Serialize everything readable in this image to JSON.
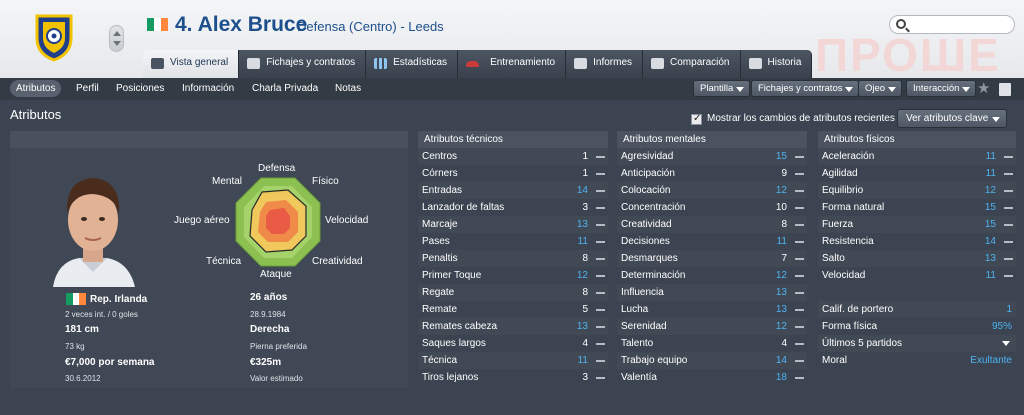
{
  "header": {
    "player_title": "4. Alex Bruce",
    "subtitle": "Defensa (Centro) - Leeds",
    "watermark": "ПРОШЕ",
    "flag_colors": [
      "#169b62",
      "#ffffff",
      "#ff883e"
    ]
  },
  "tabs": [
    {
      "label": "Vista general",
      "icon": "overview-icon",
      "active": true
    },
    {
      "label": "Fichajes y contratos",
      "icon": "contract-icon"
    },
    {
      "label": "Estadísticas",
      "icon": "stats-icon"
    },
    {
      "label": "Entrenamiento",
      "icon": "training-icon"
    },
    {
      "label": "Informes",
      "icon": "report-icon"
    },
    {
      "label": "Comparación",
      "icon": "compare-icon"
    },
    {
      "label": "Historia",
      "icon": "history-icon"
    }
  ],
  "subnav": {
    "items": [
      "Atributos",
      "Perfil",
      "Posiciones",
      "Información",
      "Charla Privada",
      "Notas"
    ],
    "dropdowns": [
      "Plantilla",
      "Fichajes y contratos",
      "Ojeo",
      "Interacción"
    ]
  },
  "section": {
    "title": "Atributos",
    "checkbox_label": "Mostrar los cambios de atributos recientes",
    "key_button": "Ver atributos clave"
  },
  "radar": {
    "labels": {
      "top": "Defensa",
      "top_right": "Físico",
      "right": "Velocidad",
      "bottom_right": "Creatividad",
      "bottom": "Ataque",
      "bottom_left": "Técnica",
      "left": "Juego aéreo",
      "top_left": "Mental"
    }
  },
  "player": {
    "nation": "Rep. Irlanda",
    "caps": "2 veces int. / 0 goles",
    "height": "181 cm",
    "weight": "73 kg",
    "wage": "€7,000 por semana",
    "contract_end": "30.6.2012",
    "age": "26 años",
    "birthdate": "28.9.1984",
    "foot": "Derecha",
    "foot_label": "Pierna preferida",
    "value": "€325m",
    "value_label": "Valor estimado"
  },
  "technical": {
    "header": "Atributos técnicos",
    "rows": [
      {
        "name": "Centros",
        "value": "1"
      },
      {
        "name": "Córners",
        "value": "1"
      },
      {
        "name": "Entradas",
        "value": "14",
        "hi": true
      },
      {
        "name": "Lanzador de faltas",
        "value": "3"
      },
      {
        "name": "Marcaje",
        "value": "13",
        "hi": true
      },
      {
        "name": "Pases",
        "value": "11",
        "hi": true
      },
      {
        "name": "Penaltis",
        "value": "8"
      },
      {
        "name": "Primer Toque",
        "value": "12",
        "hi": true
      },
      {
        "name": "Regate",
        "value": "8"
      },
      {
        "name": "Remate",
        "value": "5"
      },
      {
        "name": "Remates cabeza",
        "value": "13",
        "hi": true
      },
      {
        "name": "Saques largos",
        "value": "4"
      },
      {
        "name": "Técnica",
        "value": "11",
        "hi": true
      },
      {
        "name": "Tiros lejanos",
        "value": "3"
      }
    ]
  },
  "mental": {
    "header": "Atributos mentales",
    "rows": [
      {
        "name": "Agresividad",
        "value": "15",
        "hi": true
      },
      {
        "name": "Anticipación",
        "value": "9"
      },
      {
        "name": "Colocación",
        "value": "12",
        "hi": true
      },
      {
        "name": "Concentración",
        "value": "10"
      },
      {
        "name": "Creatividad",
        "value": "8"
      },
      {
        "name": "Decisiones",
        "value": "11",
        "hi": true
      },
      {
        "name": "Desmarques",
        "value": "7"
      },
      {
        "name": "Determinación",
        "value": "12",
        "hi": true
      },
      {
        "name": "Influencia",
        "value": "13",
        "hi": true
      },
      {
        "name": "Lucha",
        "value": "13",
        "hi": true
      },
      {
        "name": "Serenidad",
        "value": "12",
        "hi": true
      },
      {
        "name": "Talento",
        "value": "4"
      },
      {
        "name": "Trabajo equipo",
        "value": "14",
        "hi": true
      },
      {
        "name": "Valentía",
        "value": "18",
        "hi": true
      }
    ]
  },
  "physical": {
    "header": "Atributos físicos",
    "rows": [
      {
        "name": "Aceleración",
        "value": "11",
        "hi": true
      },
      {
        "name": "Agilidad",
        "value": "11",
        "hi": true
      },
      {
        "name": "Equilibrio",
        "value": "12",
        "hi": true
      },
      {
        "name": "Forma natural",
        "value": "15",
        "hi": true
      },
      {
        "name": "Fuerza",
        "value": "15",
        "hi": true
      },
      {
        "name": "Resistencia",
        "value": "14",
        "hi": true
      },
      {
        "name": "Salto",
        "value": "13",
        "hi": true
      },
      {
        "name": "Velocidad",
        "value": "11",
        "hi": true
      }
    ],
    "extra": [
      {
        "name": "Calif. de portero",
        "value": "1"
      },
      {
        "name": "Forma física",
        "value": "95%"
      },
      {
        "name": "Últimos 5 partidos",
        "value": ""
      },
      {
        "name": "Moral",
        "value": "Exultante"
      }
    ]
  }
}
